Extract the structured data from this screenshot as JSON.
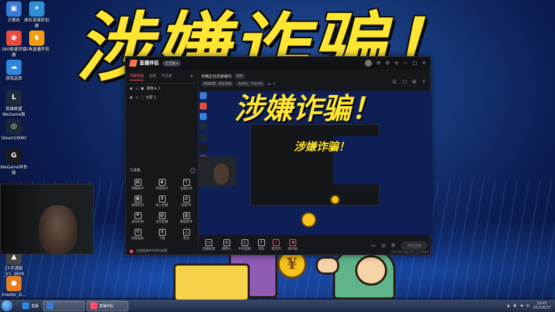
{
  "wallpaper": {
    "headline": "涉嫌诈骗！"
  },
  "desktop_icons": [
    {
      "label": "计算机",
      "color": "#3b7bd8",
      "glyph": "▣"
    },
    {
      "label": "疯狂英雄折扣器",
      "color": "#2e8fd6",
      "glyph": "✦"
    },
    {
      "label": "360极速浏览器",
      "color": "#e74c3c",
      "glyph": "◉"
    },
    {
      "label": "斗鱼直播伴侣",
      "color": "#f39c12",
      "glyph": "♞"
    },
    {
      "label": "游戏选单",
      "color": "#2e86de",
      "glyph": "☁"
    },
    {
      "label": "英雄联盟WeGame版",
      "color": "#1d2a3a",
      "glyph": "L"
    },
    {
      "label": "Steam(WIN)",
      "color": "#1b2838",
      "glyph": "◎"
    },
    {
      "label": "WeGame同名版",
      "color": "#1b1b1b",
      "glyph": "G"
    },
    {
      "label": "CF手游版_V1_3609",
      "color": "#444",
      "glyph": "▲"
    },
    {
      "label": "master_D...",
      "color": "#e67e22",
      "glyph": "●"
    }
  ],
  "app": {
    "name": "直播伴侣",
    "badge": "正式版 ▾",
    "tabs": [
      "场景管理",
      "音频",
      "可见度"
    ],
    "sources": [
      {
        "label": "摄像头 1"
      },
      {
        "label": "全屏 1"
      }
    ],
    "toolbox_title": "工具箱",
    "tools": [
      {
        "label": "弹幕助手",
        "glyph": "▤"
      },
      {
        "label": "房管助手",
        "glyph": "♟"
      },
      {
        "label": "主播任务",
        "glyph": "✎"
      },
      {
        "label": "直播语音",
        "glyph": "▦"
      },
      {
        "label": "录入直播",
        "glyph": "⬇"
      },
      {
        "label": "连麦PK",
        "glyph": "⇄"
      },
      {
        "label": "虚拟形象",
        "glyph": "⚑"
      },
      {
        "label": "全民直播",
        "glyph": "▧"
      },
      {
        "label": "数据助手",
        "glyph": "▥"
      },
      {
        "label": "观看福利",
        "glyph": "⟲"
      },
      {
        "label": "下载",
        "glyph": "⬇"
      },
      {
        "label": "更多",
        "glyph": "△"
      }
    ],
    "footer_text": "主播直播中的密码提醒",
    "room_title": "你确定这就是骗吗",
    "room_edit": "修改",
    "room_category": "英雄联盟 · 疯狂英雄",
    "room_id": "房间号：706768",
    "room_viewers": "0",
    "bottom_buttons": [
      {
        "label": "直播画面",
        "glyph": "▭",
        "red": false
      },
      {
        "label": "摄像头",
        "glyph": "◎",
        "red": false
      },
      {
        "label": "手机直播",
        "glyph": "▯",
        "red": false
      },
      {
        "label": "添加",
        "glyph": "+",
        "red": false
      },
      {
        "label": "麦克风",
        "glyph": "♪",
        "red": true
      },
      {
        "label": "扬声器",
        "glyph": "◀",
        "red": true
      }
    ],
    "go_live_label": "开始直播",
    "stats_line": "CPU 0%  内存 0%  上行 0kb/s"
  },
  "taskbar": {
    "items": [
      {
        "label": "直播",
        "boxed": false,
        "color": "#2e86de"
      },
      {
        "label": "",
        "boxed": true,
        "color": "#3b7bd8"
      },
      {
        "label": "直播伴侣",
        "boxed": true,
        "color": "#ff4d6a"
      }
    ],
    "clock_time": "19:47",
    "clock_date": "2021/6/17"
  }
}
